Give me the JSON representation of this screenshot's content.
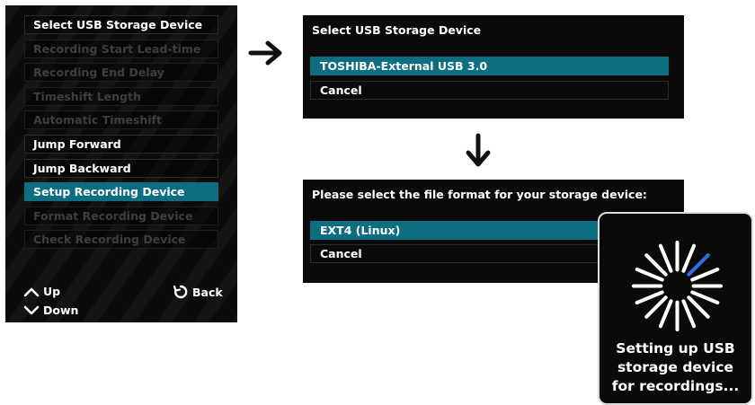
{
  "menu": {
    "items": [
      {
        "label": "Select USB Storage Device",
        "state": "enabled"
      },
      {
        "label": "Recording Start Lead-time",
        "state": "disabled"
      },
      {
        "label": "Recording End Delay",
        "state": "disabled"
      },
      {
        "label": "Timeshift Length",
        "state": "disabled"
      },
      {
        "label": "Automatic Timeshift",
        "state": "disabled"
      },
      {
        "label": "Jump Forward",
        "state": "enabled"
      },
      {
        "label": "Jump Backward",
        "state": "enabled"
      },
      {
        "label": "Setup Recording Device",
        "state": "selected"
      },
      {
        "label": "Format Recording Device",
        "state": "disabled"
      },
      {
        "label": "Check Recording Device",
        "state": "disabled"
      }
    ],
    "footer": {
      "up": "Up",
      "down": "Down",
      "back": "Back"
    }
  },
  "usb_dialog": {
    "title": "Select USB Storage Device",
    "options": [
      "TOSHIBA-External USB 3.0",
      "Cancel"
    ],
    "selected_index": 0
  },
  "format_dialog": {
    "title": "Please select the file format for your storage device:",
    "options": [
      "EXT4 (Linux)",
      "Cancel"
    ],
    "selected_index": 0
  },
  "progress": {
    "message": "Setting up USB storage device for recordings..."
  },
  "colors": {
    "selected": "#0e6d80",
    "panel_bg": "#0a0a0a",
    "spinner_active": "#2f6fe0"
  },
  "icons": [
    "chevron-up-icon",
    "chevron-down-icon",
    "back-icon",
    "arrow-right-icon",
    "arrow-down-icon",
    "loading-spinner-icon"
  ]
}
